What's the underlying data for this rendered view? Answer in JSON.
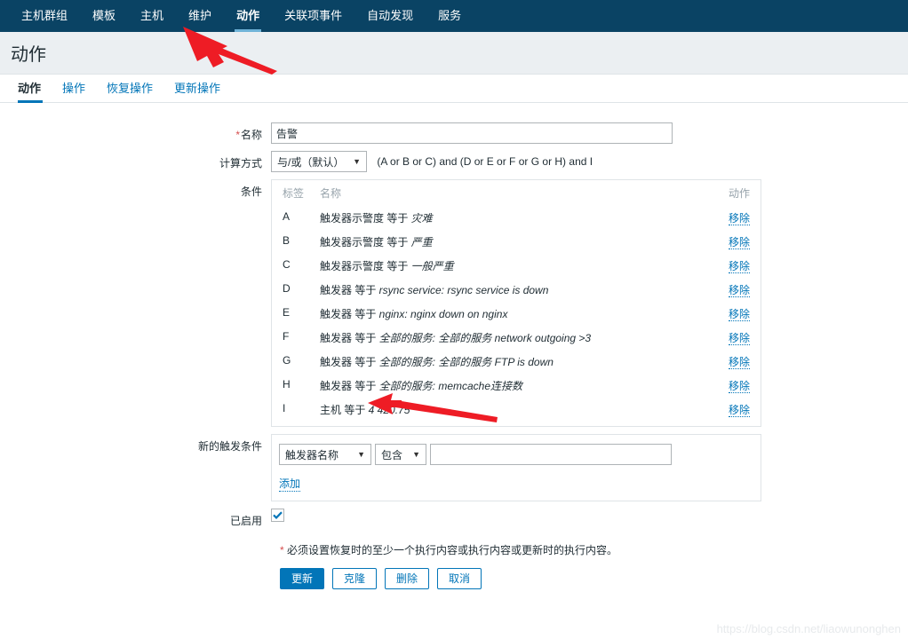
{
  "nav": {
    "items": [
      {
        "label": "主机群组",
        "active": false
      },
      {
        "label": "模板",
        "active": false
      },
      {
        "label": "主机",
        "active": false
      },
      {
        "label": "维护",
        "active": false
      },
      {
        "label": "动作",
        "active": true
      },
      {
        "label": "关联项事件",
        "active": false
      },
      {
        "label": "自动发现",
        "active": false
      },
      {
        "label": "服务",
        "active": false
      }
    ]
  },
  "header": {
    "title": "动作"
  },
  "tabs": [
    {
      "label": "动作",
      "active": true
    },
    {
      "label": "操作",
      "active": false
    },
    {
      "label": "恢复操作",
      "active": false
    },
    {
      "label": "更新操作",
      "active": false
    }
  ],
  "form": {
    "name": {
      "label": "名称",
      "required": "*",
      "value": "告警",
      "placeholder": ""
    },
    "calculation": {
      "label": "计算方式",
      "selected": "与/或（默认）",
      "formula": "(A or B or C) and (D or E or F or G or H) and I"
    },
    "conditions": {
      "label": "条件",
      "columns": {
        "label": "标签",
        "name": "名称",
        "action": "动作"
      },
      "remove_label": "移除",
      "rows": [
        {
          "label": "A",
          "prefix": "触发器示警度 等于",
          "value": "灾难"
        },
        {
          "label": "B",
          "prefix": "触发器示警度 等于",
          "value": "严重"
        },
        {
          "label": "C",
          "prefix": "触发器示警度 等于",
          "value": "一般严重"
        },
        {
          "label": "D",
          "prefix": "触发器 等于",
          "value": "rsync service: rsync service is down"
        },
        {
          "label": "E",
          "prefix": "触发器 等于",
          "value": "nginx: nginx down on nginx"
        },
        {
          "label": "F",
          "prefix": "触发器 等于",
          "value": "全部的服务: 全部的服务 network outgoing >3"
        },
        {
          "label": "G",
          "prefix": "触发器 等于",
          "value": "全部的服务: 全部的服务 FTP is down"
        },
        {
          "label": "H",
          "prefix": "触发器 等于",
          "value": "全部的服务: memcache连接数"
        },
        {
          "label": "I",
          "prefix": "主机 等于",
          "value": "4      420.75"
        }
      ]
    },
    "new_condition": {
      "label": "新的触发条件",
      "type_selected": "触发器名称",
      "operator_selected": "包含",
      "value": "",
      "placeholder": "",
      "add_label": "添加"
    },
    "enabled": {
      "label": "已启用",
      "checked": true
    },
    "note": {
      "required": "*",
      "text": "必须设置恢复时的至少一个执行内容或执行内容或更新时的执行内容。"
    },
    "buttons": [
      {
        "label": "更新",
        "primary": true
      },
      {
        "label": "克隆",
        "primary": false
      },
      {
        "label": "删除",
        "primary": false
      },
      {
        "label": "取消",
        "primary": false
      }
    ]
  },
  "watermark": "https://blog.csdn.net/liaowunonghen",
  "colors": {
    "nav_bg": "#0a4364",
    "accent": "#0275b8",
    "required": "#d64e4e",
    "arrow": "#ee1c25"
  }
}
